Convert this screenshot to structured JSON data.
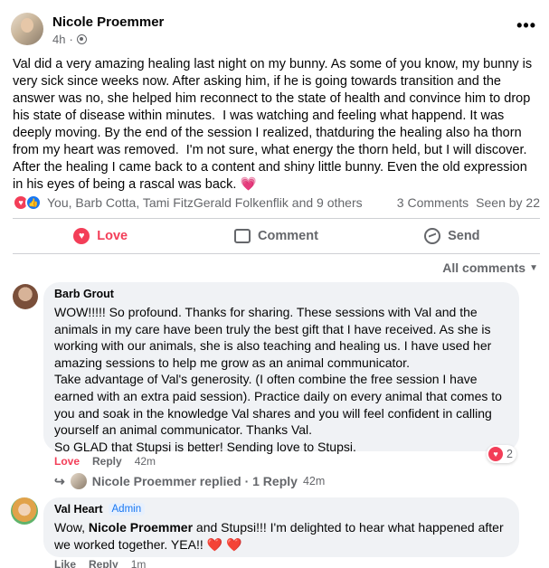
{
  "post": {
    "author": "Nicole Proemmer",
    "time": "4h",
    "more_label": "•••",
    "body": "Val did a very amazing healing last night on my bunny. As some of you know, my bunny is very sick since weeks now. After asking him, if he is going towards transition and the answer was no, she helped him reconnect to the state of health and convince him to drop his state of disease within minutes.  I was watching and feeling what happend. It was deeply moving. By the end of the session I realized, thatduring the healing also ha thorn from my heart was removed.  I'm not sure, what energy the thorn held, but I will discover.\nAfter the healing I came back to a content and shiny little bunny. Even the old expression in his eyes of being a rascal was back. 💗"
  },
  "reactions": {
    "names": "You, Barb Cotta, Tami FitzGerald Folkenflik and 9 others",
    "comments": "3 Comments",
    "seen": "Seen by 22"
  },
  "actions": {
    "love": "Love",
    "comment": "Comment",
    "send": "Send"
  },
  "filter": {
    "label": "All comments"
  },
  "comments": [
    {
      "author": "Barb Grout",
      "text": "WOW!!!!! So profound. Thanks for sharing. These sessions with Val and the animals in my care have been truly the best gift that I have received. As she is working with our animals, she is also teaching and healing us. I have used her amazing sessions to help me grow as an animal communicator.\nTake advantage of Val's generosity. (I often combine the free session I have earned with an extra paid session). Practice daily on every animal that comes to you and soak in the knowledge Val shares and you will feel confident in calling yourself an animal communicator. Thanks Val.\nSo GLAD that Stupsi is better! Sending love to Stupsi.",
      "reaction_count": "2",
      "love_label": "Love",
      "reply_label": "Reply",
      "time": "42m",
      "replies": {
        "text": "Nicole Proemmer replied · 1 Reply",
        "time": "42m"
      }
    },
    {
      "author": "Val Heart",
      "badge": "Admin",
      "text_prefix": "Wow, ",
      "mention": "Nicole Proemmer",
      "text_suffix": " and Stupsi!!! I'm delighted to hear what happened after we worked together. YEA!! ",
      "like_label": "Like",
      "reply_label": "Reply",
      "time": "1m"
    }
  ],
  "colors": {
    "love": "#f33e58",
    "like": "#1877f2",
    "muted": "#65676b",
    "bubble": "#f0f2f5"
  }
}
